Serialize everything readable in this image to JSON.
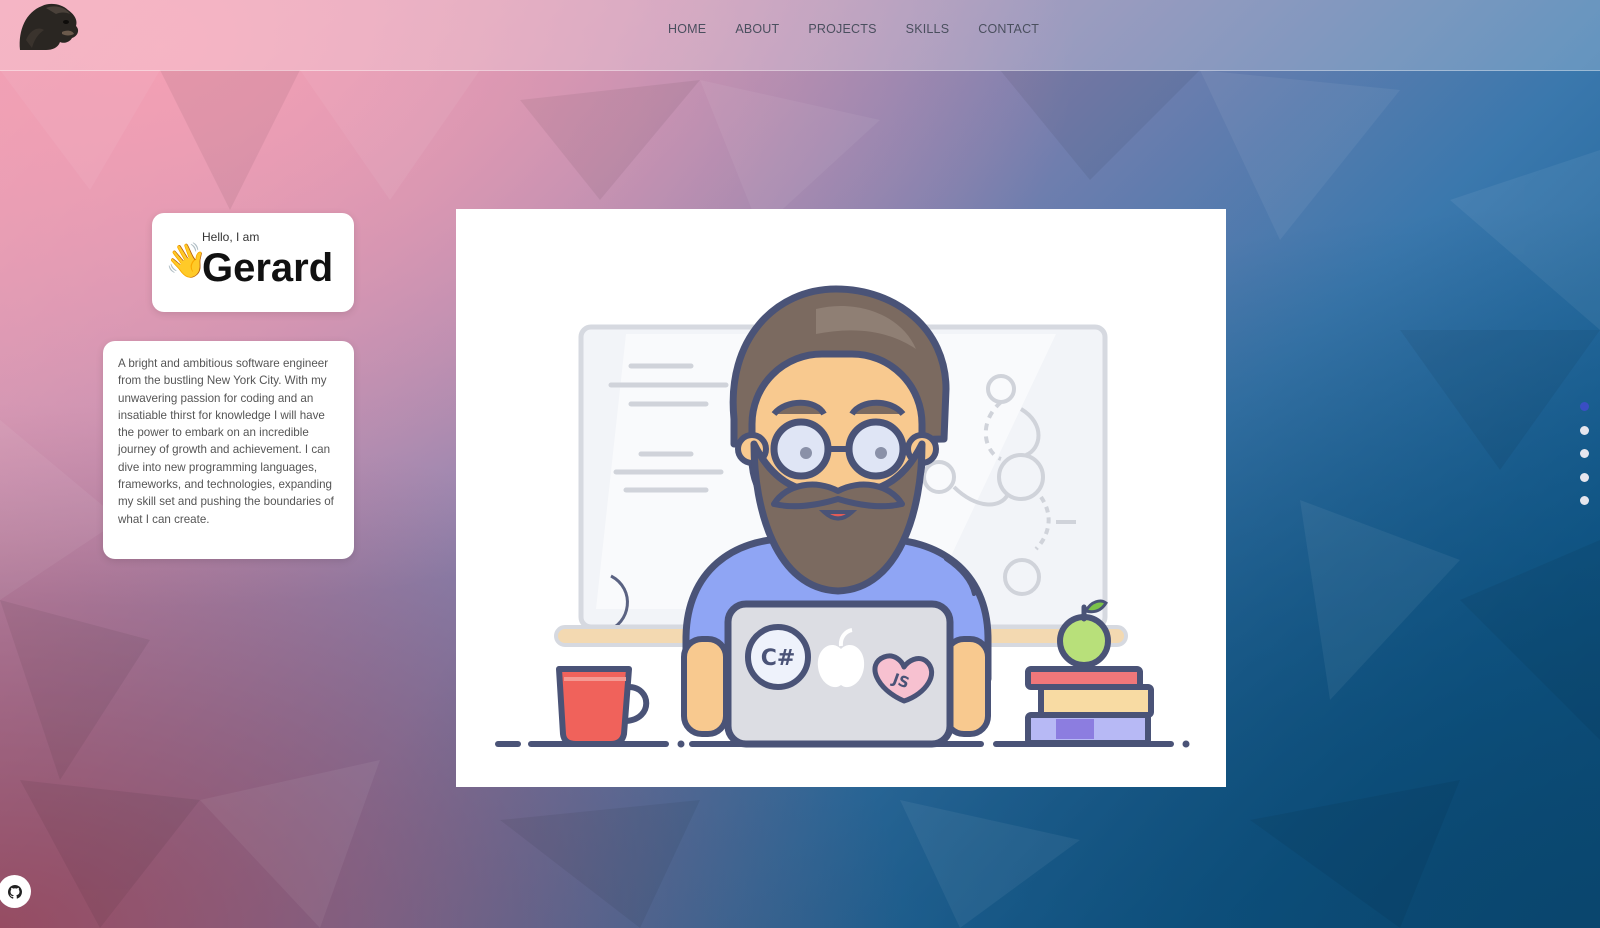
{
  "nav": {
    "items": [
      {
        "label": "HOME"
      },
      {
        "label": "ABOUT"
      },
      {
        "label": "PROJECTS"
      },
      {
        "label": "SKILLS"
      },
      {
        "label": "CONTACT"
      }
    ]
  },
  "logo": {
    "icon": "gorilla-logo-icon"
  },
  "intro": {
    "greeting": "Hello, I am",
    "wave": "👋",
    "name": "Gerard"
  },
  "bio": {
    "text": "A bright and ambitious software engineer from the bustling New York City. With my unwavering passion for coding and an insatiable thirst for knowledge I will have the power to embark on an incredible journey of growth and achievement. I can dive into new programming languages, frameworks, and technologies, expanding my skill set and pushing the boundaries of what I can create."
  },
  "hero": {
    "laptop_sticker_1": "C#",
    "laptop_sticker_2": "JS"
  },
  "section_dots": {
    "count": 5,
    "active_index": 0,
    "active_color": "#3a4ec4"
  },
  "social": {
    "icon": "github-icon"
  }
}
